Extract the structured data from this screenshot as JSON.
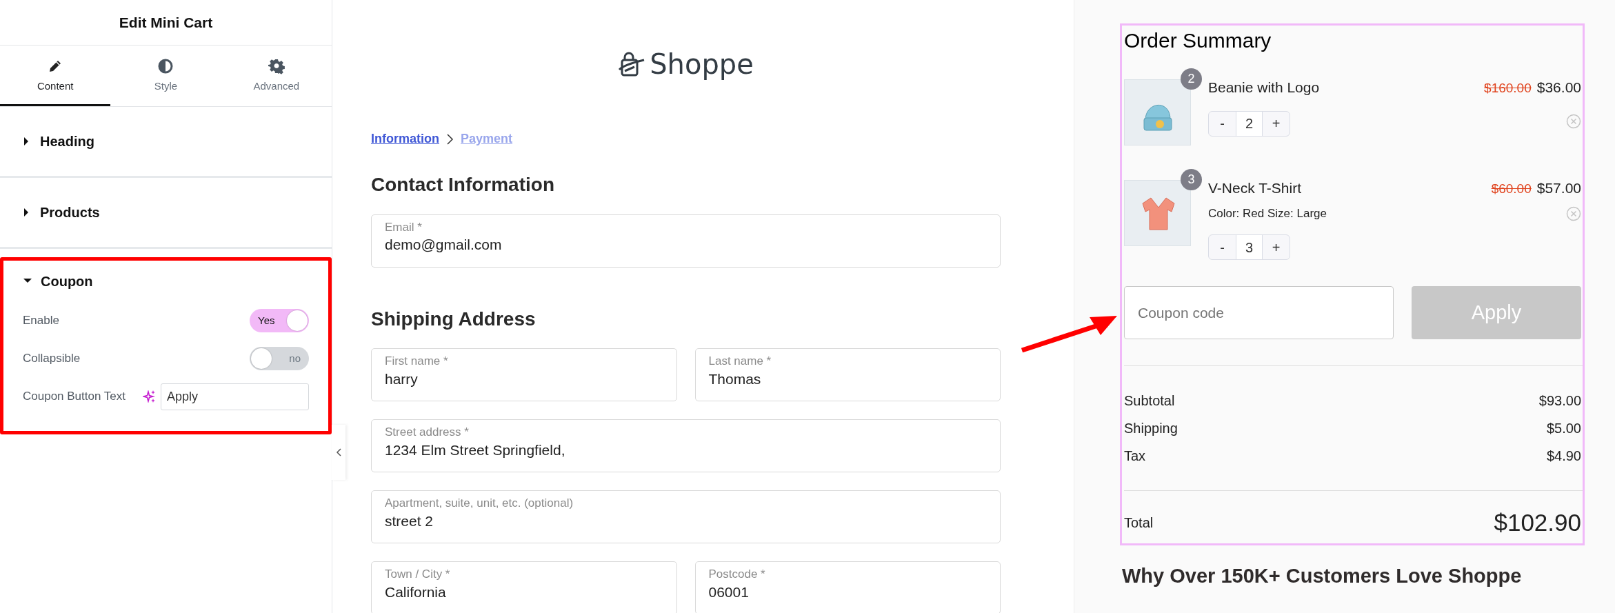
{
  "editor": {
    "title": "Edit Mini Cart",
    "tabs": [
      {
        "label": "Content",
        "kind": "pencil",
        "selected": true
      },
      {
        "label": "Style",
        "kind": "contrast",
        "selected": false
      },
      {
        "label": "Advanced",
        "kind": "gear",
        "selected": false
      }
    ],
    "sections": [
      {
        "title": "Heading",
        "expanded": false,
        "highlighted": false
      },
      {
        "title": "Products",
        "expanded": false,
        "highlighted": false
      },
      {
        "title": "Coupon",
        "expanded": true,
        "highlighted": true,
        "controls": [
          {
            "kind": "toggle",
            "label": "Enable",
            "on": true,
            "text": "Yes"
          },
          {
            "kind": "toggle",
            "label": "Collapsible",
            "on": false,
            "text": "no"
          },
          {
            "kind": "text",
            "label": "Coupon Button Text",
            "value": "Apply"
          }
        ]
      }
    ]
  },
  "checkout": {
    "logo": "Shoppe",
    "breadcrumb": [
      {
        "label": "Information",
        "selected": true
      },
      {
        "label": "Payment",
        "selected": false
      }
    ],
    "sections": [
      {
        "title": "Contact Information",
        "rows": [
          [
            {
              "label": "Email *",
              "value": "demo@gmail.com"
            }
          ]
        ]
      },
      {
        "title": "Shipping Address",
        "rows": [
          [
            {
              "label": "First name *",
              "value": "harry"
            },
            {
              "label": "Last name *",
              "value": "Thomas"
            }
          ],
          [
            {
              "label": "Street address *",
              "value": "1234 Elm Street Springfield,"
            }
          ],
          [
            {
              "label": "Apartment, suite, unit, etc. (optional)",
              "value": "street 2"
            }
          ],
          [
            {
              "label": "Town / City *",
              "value": "California"
            },
            {
              "label": "Postcode *",
              "value": "06001"
            }
          ]
        ]
      }
    ]
  },
  "order_summary": {
    "title": "Order Summary",
    "items": [
      {
        "kind": "beanie",
        "count": "2",
        "name": "Beanie with Logo",
        "old_price": "$160.00",
        "price": "$36.00",
        "minus": "-",
        "quantity": "2",
        "plus": "+"
      },
      {
        "kind": "tshirt",
        "count": "3",
        "name": "V-Neck T-Shirt",
        "variation": "Color:  Red Size:  Large",
        "old_price": "$60.00",
        "price": "$57.00",
        "minus": "-",
        "quantity": "3",
        "plus": "+"
      }
    ],
    "coupon": {
      "placeholder": "Coupon code",
      "button": "Apply",
      "disabled": true
    },
    "totals": [
      {
        "label": "Subtotal",
        "value": "$93.00"
      },
      {
        "label": "Shipping",
        "value": "$5.00"
      },
      {
        "label": "Tax",
        "value": "$4.90"
      }
    ],
    "total": {
      "label": "Total",
      "value": "$102.90"
    }
  },
  "promo_heading": "Why Over 150K+ Customers Love Shoppe"
}
